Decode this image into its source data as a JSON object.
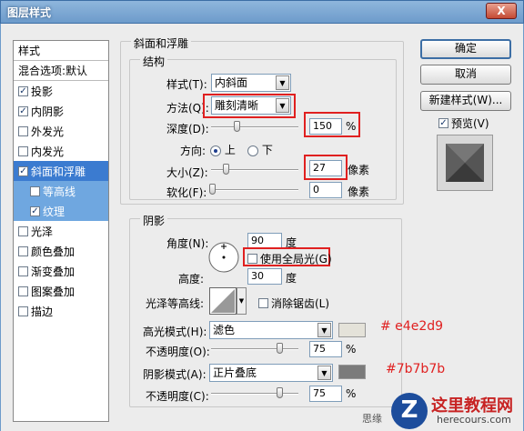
{
  "window": {
    "title": "图层样式",
    "close": "X"
  },
  "left_panel": {
    "header": "样式",
    "blend": "混合选项:默认",
    "items": [
      {
        "label": "投影",
        "checked": true
      },
      {
        "label": "内阴影",
        "checked": true
      },
      {
        "label": "外发光",
        "checked": false
      },
      {
        "label": "内发光",
        "checked": false
      },
      {
        "label": "斜面和浮雕",
        "checked": true
      },
      {
        "label": "等高线",
        "checked": false
      },
      {
        "label": "纹理",
        "checked": true
      },
      {
        "label": "光泽",
        "checked": false
      },
      {
        "label": "颜色叠加",
        "checked": false
      },
      {
        "label": "渐变叠加",
        "checked": false
      },
      {
        "label": "图案叠加",
        "checked": false
      },
      {
        "label": "描边",
        "checked": false
      }
    ]
  },
  "bevel": {
    "section": "斜面和浮雕",
    "structure": "结构",
    "style_label": "样式(T):",
    "style_value": "内斜面",
    "method_label": "方法(Q):",
    "method_value": "雕刻清晰",
    "depth_label": "深度(D):",
    "depth_value": "150",
    "depth_unit": "%",
    "direction_label": "方向:",
    "dir_up": "上",
    "dir_down": "下",
    "size_label": "大小(Z):",
    "size_value": "27",
    "size_unit": "像素",
    "soften_label": "软化(F):",
    "soften_value": "0",
    "soften_unit": "像素"
  },
  "shading": {
    "section": "阴影",
    "angle_label": "角度(N):",
    "angle_value": "90",
    "angle_unit": "度",
    "global_light": "使用全局光(G)",
    "altitude_label": "高度:",
    "altitude_value": "30",
    "altitude_unit": "度",
    "gloss_label": "光泽等高线:",
    "antialias": "消除锯齿(L)",
    "highlight_label": "高光模式(H):",
    "highlight_value": "滤色",
    "highlight_color": "#e4e2d9",
    "highlight_note": "# e4e2d9",
    "hl_opacity_label": "不透明度(O):",
    "hl_opacity_value": "75",
    "hl_opacity_unit": "%",
    "shadow_label": "阴影模式(A):",
    "shadow_value": "正片叠底",
    "shadow_color": "#7b7b7b",
    "shadow_note": "#7b7b7b",
    "sh_opacity_label": "不透明度(C):",
    "sh_opacity_value": "75",
    "sh_opacity_unit": "%"
  },
  "buttons": {
    "ok": "确定",
    "cancel": "取消",
    "new_style": "新建样式(W)...",
    "preview": "预览(V)"
  },
  "watermark": {
    "title": "这里教程网",
    "url": "herecours.com",
    "footer_text": "思缘"
  }
}
